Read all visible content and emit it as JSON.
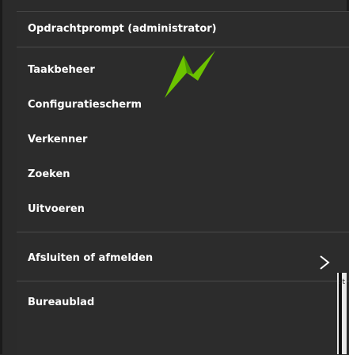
{
  "menu": {
    "header": "Opdrachtprompt (administrator)",
    "items": [
      {
        "label": "Taakbeheer"
      },
      {
        "label": "Configuratiescherm"
      },
      {
        "label": "Verkenner"
      },
      {
        "label": "Zoeken"
      },
      {
        "label": "Uitvoeren"
      },
      {
        "label": "Afsluiten of afmelden",
        "has_submenu": true
      },
      {
        "label": "Bureaublad"
      }
    ]
  },
  "colors": {
    "background": "#2b2b2b",
    "text": "#ffffff",
    "separator": "#4a4a4a",
    "logo_green": "#6cc300"
  },
  "icons": {
    "submenu": "chevron-right-icon",
    "logo": "green-arrow-logo-icon"
  },
  "edge_fragment": {
    "text": "st"
  }
}
